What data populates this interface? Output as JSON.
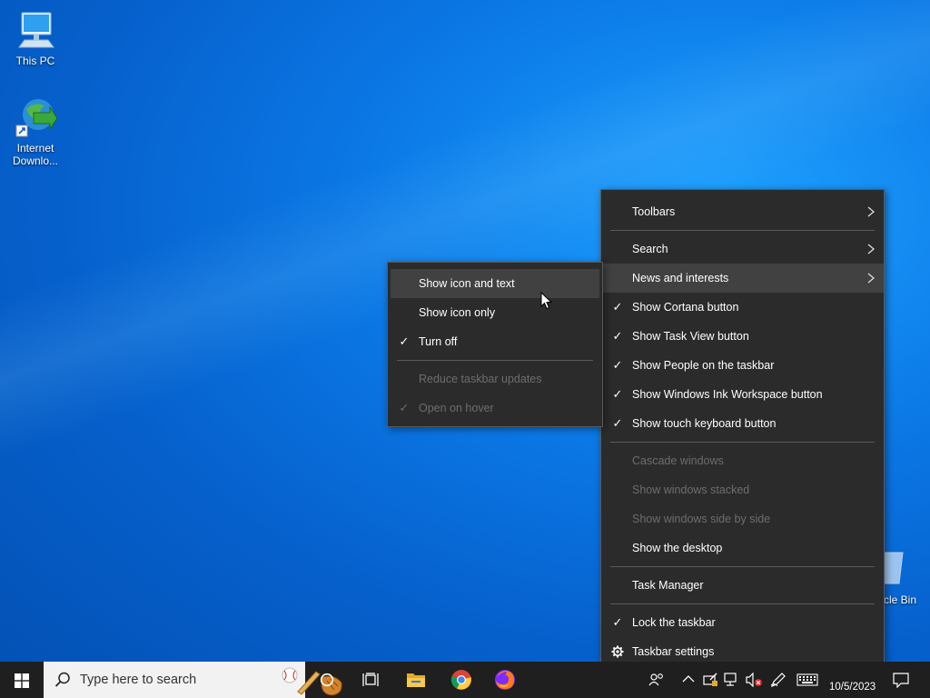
{
  "desktop": {
    "icons": [
      {
        "label": "This PC"
      },
      {
        "label": "Internet Downlo..."
      },
      {
        "label": "cle Bin"
      }
    ]
  },
  "context_menu": {
    "items": [
      {
        "label": "Toolbars",
        "submenu": true
      },
      {
        "label": "Search",
        "submenu": true
      },
      {
        "label": "News and interests",
        "submenu": true,
        "highlighted": true
      },
      {
        "label": "Show Cortana button",
        "checked": true
      },
      {
        "label": "Show Task View button",
        "checked": true
      },
      {
        "label": "Show People on the taskbar",
        "checked": true
      },
      {
        "label": "Show Windows Ink Workspace button",
        "checked": true
      },
      {
        "label": "Show touch keyboard button",
        "checked": true
      },
      {
        "label": "Cascade windows",
        "disabled": true
      },
      {
        "label": "Show windows stacked",
        "disabled": true
      },
      {
        "label": "Show windows side by side",
        "disabled": true
      },
      {
        "label": "Show the desktop"
      },
      {
        "label": "Task Manager"
      },
      {
        "label": "Lock the taskbar",
        "checked": true
      },
      {
        "label": "Taskbar settings",
        "icon": "gear-icon"
      }
    ]
  },
  "submenu": {
    "items": [
      {
        "label": "Show icon and text",
        "highlighted": true
      },
      {
        "label": "Show icon only"
      },
      {
        "label": "Turn off",
        "checked": true
      },
      {
        "label": "Reduce taskbar updates",
        "disabled": true
      },
      {
        "label": "Open on hover",
        "disabled": true,
        "checked": true
      }
    ]
  },
  "taskbar": {
    "search_placeholder": "Type here to search",
    "clock_date": "10/5/2023",
    "apps": [
      "file-explorer-icon",
      "chrome-icon",
      "firefox-icon"
    ]
  },
  "glyphs": {
    "check": "✓"
  },
  "colors": {
    "menu_bg": "#2b2b2b",
    "menu_hover": "#414141",
    "disabled_text": "#6d6d6d",
    "taskbar_bg": "#1f1f1f"
  }
}
